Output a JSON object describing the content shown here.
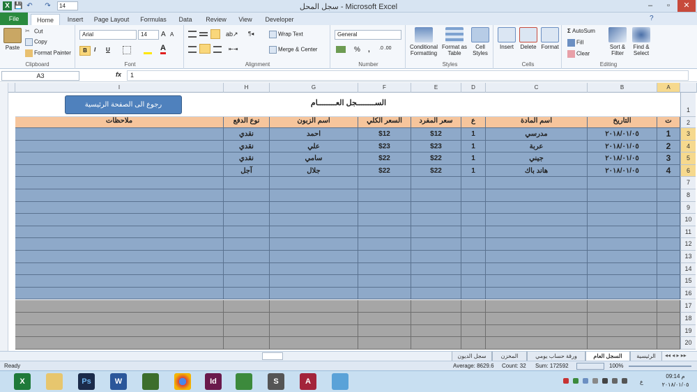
{
  "window": {
    "title": "سجل المحل - Microsoft Excel",
    "qa_font_size": "14",
    "minimize": "–",
    "restore": "▫",
    "close": "✕"
  },
  "tabs": [
    "File",
    "Home",
    "Insert",
    "Page Layout",
    "Formulas",
    "Data",
    "Review",
    "View",
    "Developer"
  ],
  "active_tab": "Home",
  "ribbon": {
    "clipboard": {
      "label": "Clipboard",
      "paste": "Paste",
      "cut": "Cut",
      "copy": "Copy",
      "format_painter": "Format Painter"
    },
    "font": {
      "label": "Font",
      "name": "Arial",
      "size": "14",
      "bold": "B",
      "italic": "I",
      "underline": "U"
    },
    "alignment": {
      "label": "Alignment",
      "wrap_text": "Wrap Text",
      "merge_center": "Merge & Center"
    },
    "number": {
      "label": "Number",
      "format": "General",
      "percent": "%",
      "comma": ","
    },
    "styles": {
      "label": "Styles",
      "conditional": "Conditional Formatting",
      "format_table": "Format as Table",
      "cell_styles": "Cell Styles"
    },
    "cells": {
      "label": "Cells",
      "insert": "Insert",
      "delete": "Delete",
      "format": "Format"
    },
    "editing": {
      "label": "Editing",
      "autosum": "AutoSum",
      "fill": "Fill",
      "clear": "Clear",
      "sort_filter": "Sort & Filter",
      "find_select": "Find & Select"
    }
  },
  "formula_bar": {
    "name_box": "A3",
    "fx": "fx",
    "value": "1"
  },
  "sheet": {
    "columns": [
      "I",
      "H",
      "G",
      "F",
      "E",
      "D",
      "C",
      "B",
      "A"
    ],
    "back_button": "رجوع الى الصفحة الرئيسية",
    "title": "الســــــــجل العــــــــام",
    "headers": {
      "notes": "ملاحظات",
      "pay_type": "نوع الدفع",
      "customer": "اسم الزبون",
      "total": "السعر الكلي",
      "unit_price": "سعر المفرد",
      "qty": "ع",
      "item": "اسم المادة",
      "date": "التاريخ",
      "num": "ت"
    },
    "rows": [
      {
        "num": "1",
        "date": "٢٠١٨/٠١/٠٥",
        "item": "مدرسي",
        "qty": "1",
        "unit_price": "$12",
        "total": "$12",
        "customer": "احمد",
        "pay_type": "نقدي",
        "notes": ""
      },
      {
        "num": "2",
        "date": "٢٠١٨/٠١/٠٥",
        "item": "عربة",
        "qty": "1",
        "unit_price": "$23",
        "total": "$23",
        "customer": "علي",
        "pay_type": "نقدي",
        "notes": ""
      },
      {
        "num": "3",
        "date": "٢٠١٨/٠١/٠٥",
        "item": "جيني",
        "qty": "1",
        "unit_price": "$22",
        "total": "$22",
        "customer": "سامي",
        "pay_type": "نقدي",
        "notes": ""
      },
      {
        "num": "4",
        "date": "٢٠١٨/٠١/٠٥",
        "item": "هاند باك",
        "qty": "1",
        "unit_price": "$22",
        "total": "$22",
        "customer": "جلال",
        "pay_type": "آجل",
        "notes": ""
      }
    ],
    "row_numbers": [
      "1",
      "2",
      "3",
      "4",
      "5",
      "6",
      "7",
      "8",
      "9",
      "10",
      "11",
      "12",
      "13",
      "14",
      "15",
      "16",
      "17",
      "18",
      "19",
      "20"
    ]
  },
  "sheet_tabs": [
    "الرئيسية",
    "السجل العام",
    "ورقة حساب يومي",
    "المخزن",
    "سجل الديون"
  ],
  "active_sheet": "السجل العام",
  "status": {
    "ready": "Ready",
    "average": "Average: 8629.6",
    "count": "Count: 32",
    "sum": "Sum: 172592",
    "zoom": "100%"
  },
  "taskbar": {
    "apps": [
      "X",
      "",
      "Ps",
      "W",
      "",
      "",
      "Id",
      "",
      "S",
      "A",
      ""
    ],
    "time": "09:14 م",
    "date": "٢٠١٨/٠١/٠٥",
    "lang": "ع"
  },
  "colors": {
    "data_fill": "#8ea9c9",
    "header_fill": "#f6c59c",
    "gray_fill": "#a6a6a6",
    "file_tab": "#2a8a3e"
  }
}
